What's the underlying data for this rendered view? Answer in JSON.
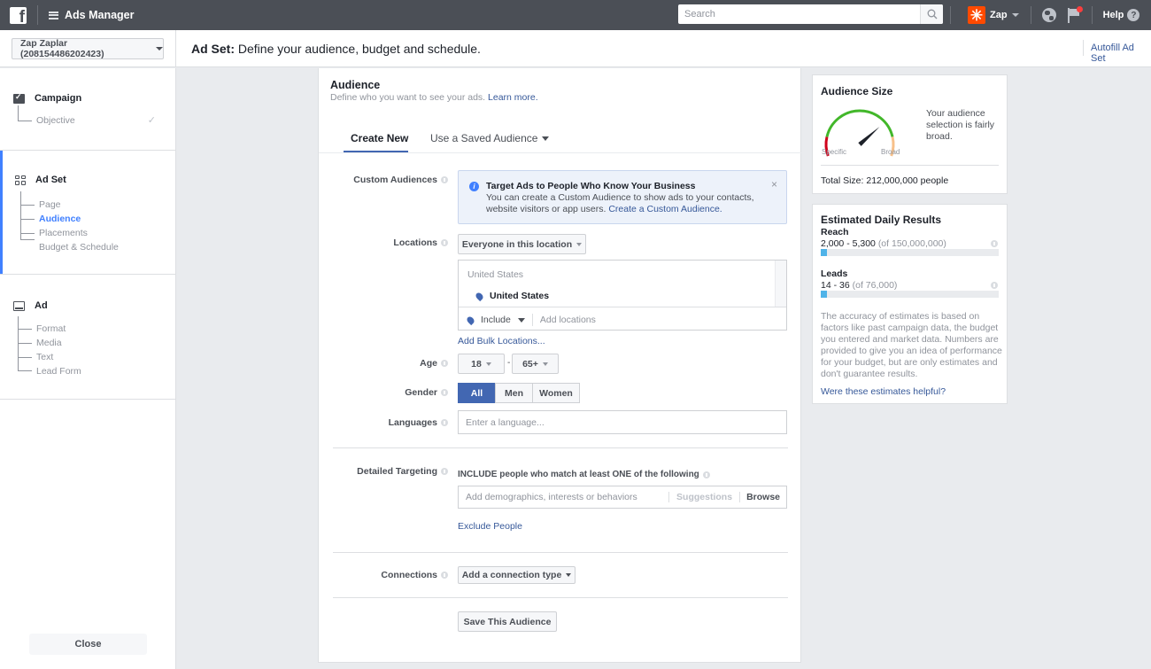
{
  "topbar": {
    "logo_letter": "f",
    "app_title": "Ads Manager",
    "search_placeholder": "Search",
    "account_name": "Zap",
    "zap_glyph": "✳",
    "help_label": "Help",
    "help_glyph": "?",
    "icons": [
      "facebook-logo-icon",
      "menu-icon",
      "search-icon",
      "zap-logo-icon",
      "globe-icon",
      "flag-icon",
      "help-icon"
    ]
  },
  "subheader": {
    "account_selector": "Zap Zaplar (208154486202423)",
    "title_bold": "Ad Set:",
    "title_rest": " Define your audience, budget and schedule.",
    "autofill": "Autofill Ad Set"
  },
  "nav": {
    "campaign": {
      "label": "Campaign",
      "items": [
        {
          "label": "Objective",
          "completed": true
        }
      ]
    },
    "adset": {
      "label": "Ad Set",
      "items": [
        {
          "label": "Page"
        },
        {
          "label": "Audience",
          "current": true
        },
        {
          "label": "Placements"
        },
        {
          "label": "Budget & Schedule"
        }
      ]
    },
    "ad": {
      "label": "Ad",
      "items": [
        {
          "label": "Format"
        },
        {
          "label": "Media"
        },
        {
          "label": "Text"
        },
        {
          "label": "Lead Form"
        }
      ]
    },
    "check_glyph": "✓",
    "close_label": "Close"
  },
  "audience": {
    "title": "Audience",
    "subtitle": "Define who you want to see your ads.",
    "learn_more": "Learn more.",
    "tabs": {
      "create_new": "Create New",
      "saved": "Use a Saved Audience"
    },
    "custom_audiences": {
      "label": "Custom Audiences",
      "notice_title": "Target Ads to People Who Know Your Business",
      "notice_body": "You can create a Custom Audience to show ads to your contacts, website visitors or app users.",
      "notice_link": "Create a Custom Audience.",
      "info_glyph": "i",
      "close_glyph": "×"
    },
    "locations": {
      "label": "Locations",
      "mode": "Everyone in this location",
      "group": "United States",
      "selected": "United States",
      "include_label": "Include",
      "add_placeholder": "Add locations",
      "bulk_link": "Add Bulk Locations..."
    },
    "age": {
      "label": "Age",
      "min": "18",
      "separator": "-",
      "max": "65+"
    },
    "gender": {
      "label": "Gender",
      "options": [
        "All",
        "Men",
        "Women"
      ],
      "selected": "All"
    },
    "languages": {
      "label": "Languages",
      "placeholder": "Enter a language..."
    },
    "detailed_targeting": {
      "label": "Detailed Targeting",
      "heading": "INCLUDE people who match at least ONE of the following",
      "placeholder": "Add demographics, interests or behaviors",
      "suggestions": "Suggestions",
      "browse": "Browse",
      "exclude_link": "Exclude People"
    },
    "connections": {
      "label": "Connections",
      "button": "Add a connection type"
    },
    "save_button": "Save This Audience"
  },
  "audience_size": {
    "title": "Audience Size",
    "gauge_left": "Specific",
    "gauge_right": "Broad",
    "gauge_level": 0.72,
    "description": "Your audience selection is fairly broad.",
    "total": "Total Size: 212,000,000 people",
    "colors": {
      "low": "#d0021b",
      "mid": "#42b72a",
      "high": "#f7c08a",
      "needle": "#1d2129"
    }
  },
  "estimated_results": {
    "title": "Estimated Daily Results",
    "reach": {
      "label": "Reach",
      "range": "2,000 - 5,300",
      "of": "(of 150,000,000)",
      "fill_fraction": 0.035
    },
    "leads": {
      "label": "Leads",
      "range": "14 - 36",
      "of": "(of 76,000)",
      "fill_fraction": 0.035
    },
    "disclaimer": "The accuracy of estimates is based on factors like past campaign data, the budget you entered and market data. Numbers are provided to give you an idea of performance for your budget, but are only estimates and don't guarantee results.",
    "helpful_link": "Were these estimates helpful?",
    "bar_color": "#4fb3e8"
  }
}
